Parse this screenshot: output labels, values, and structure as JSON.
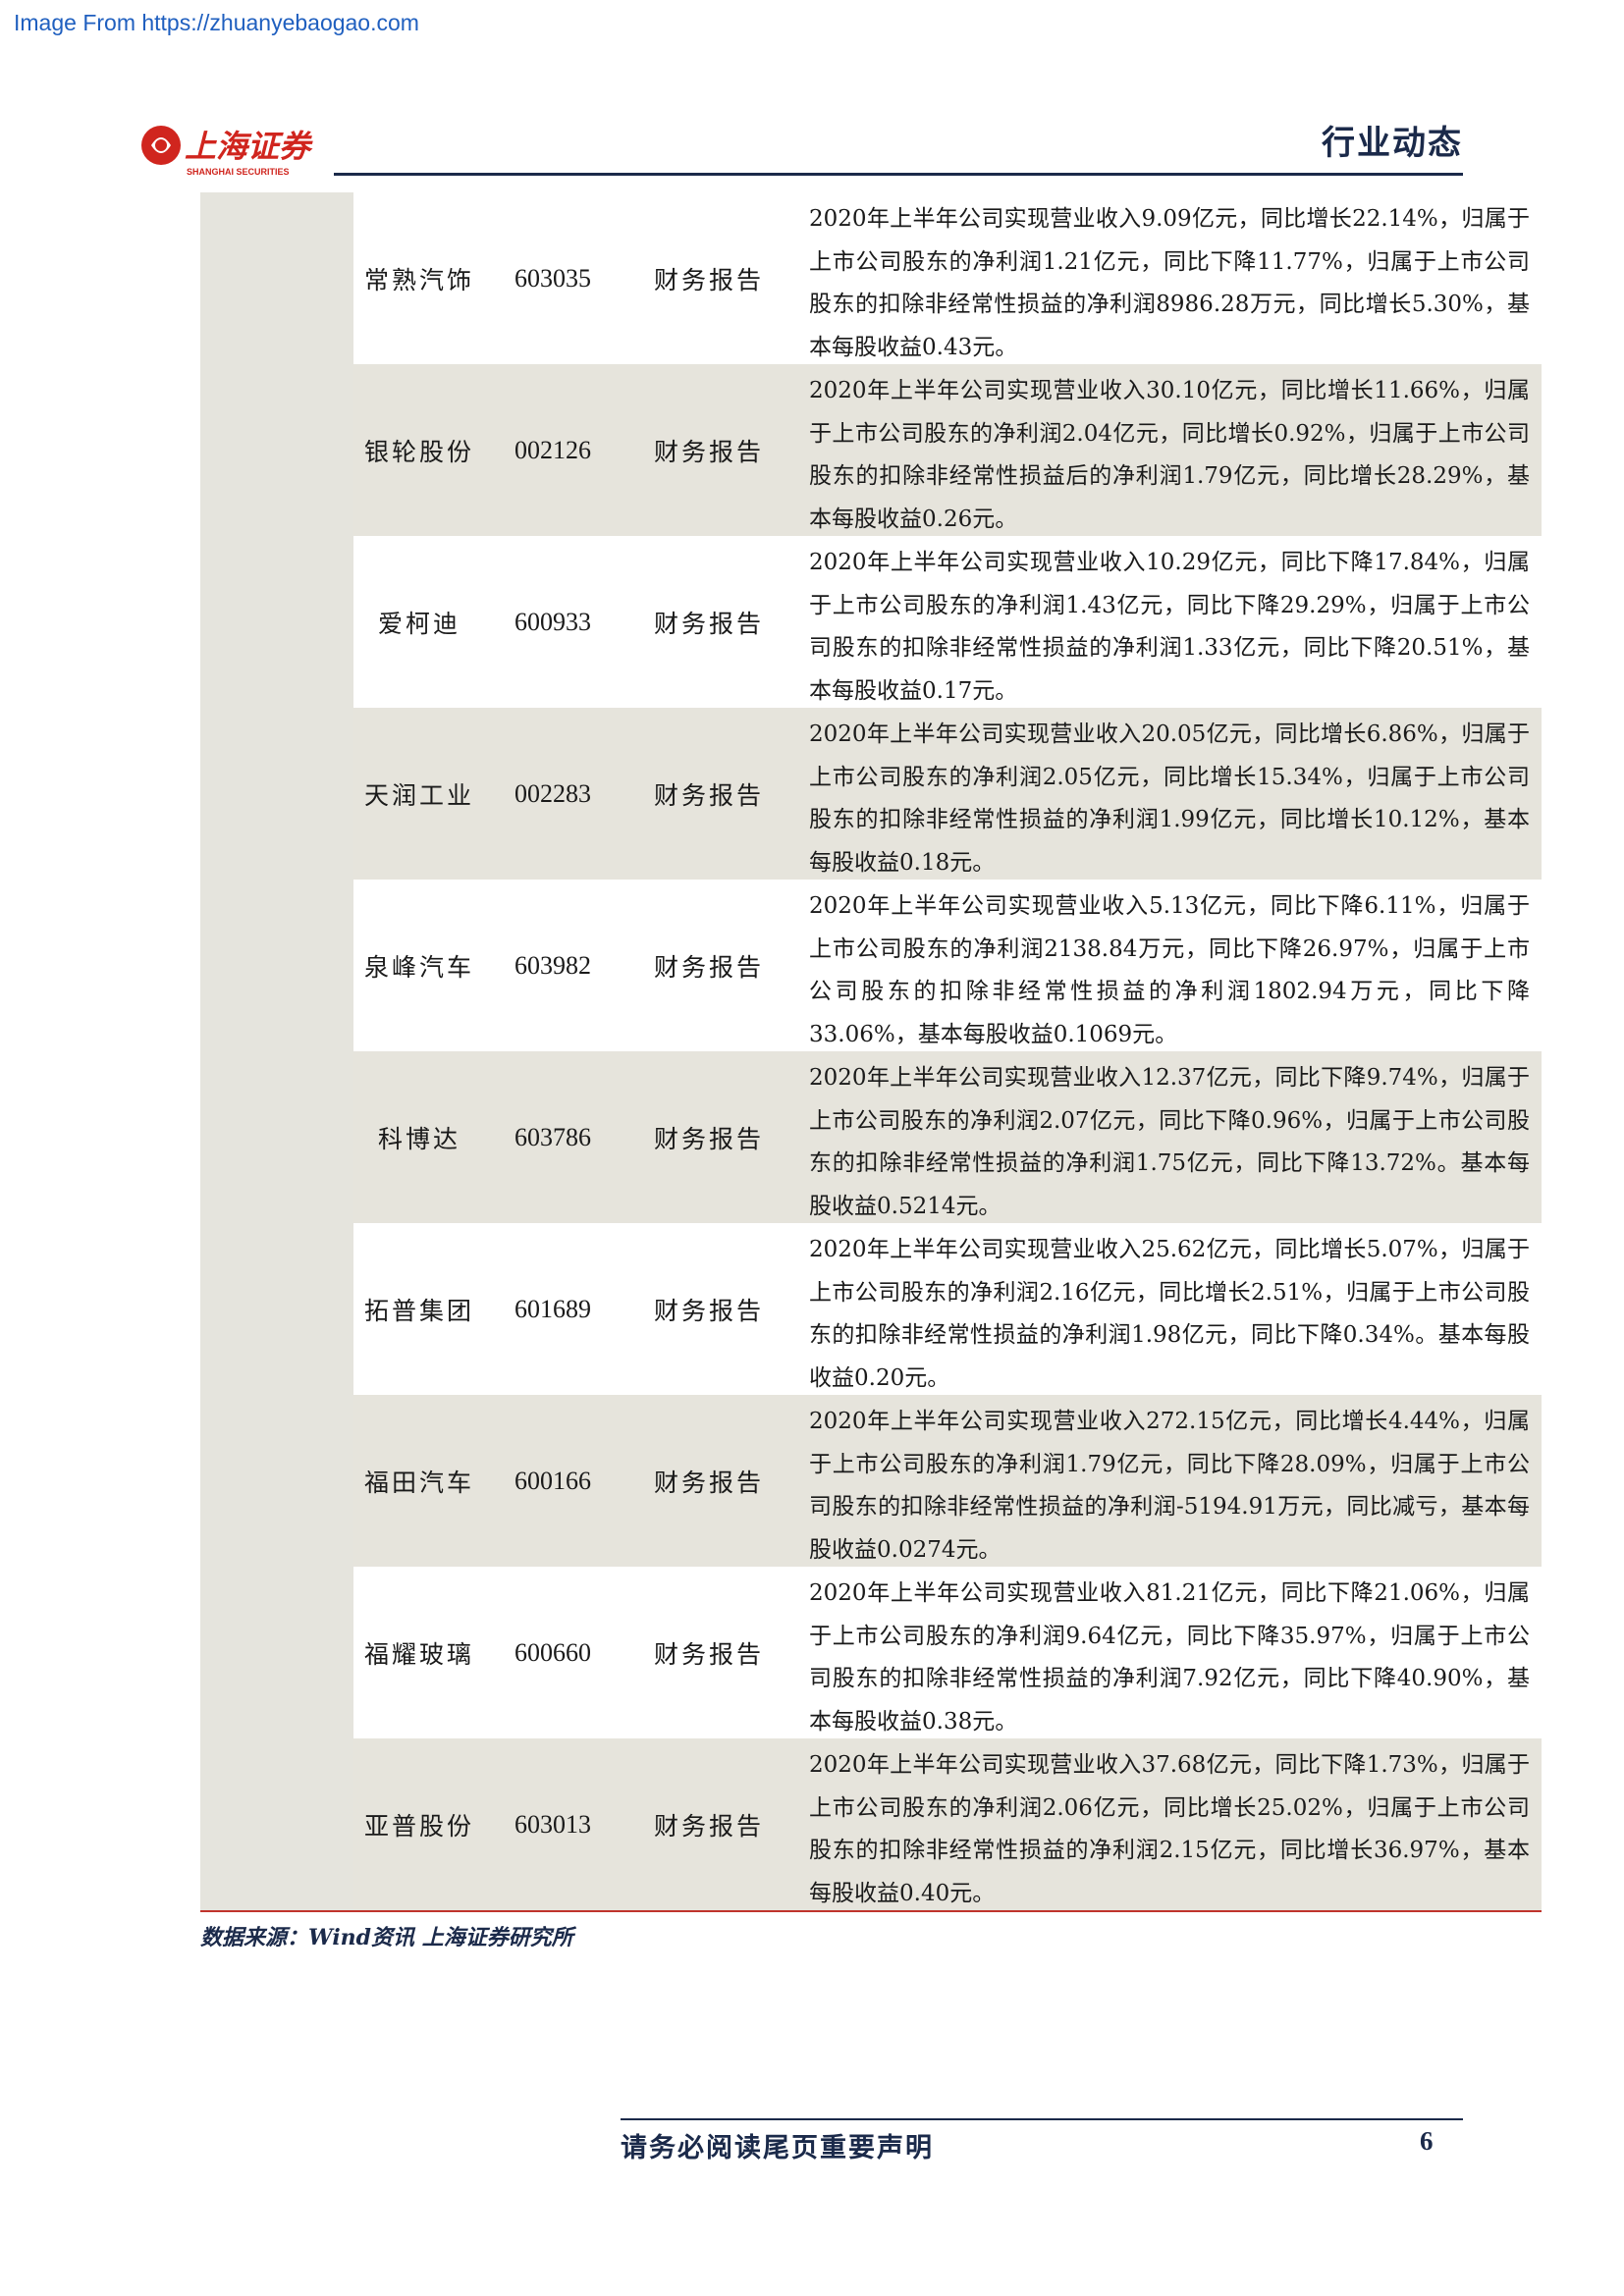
{
  "watermark": "Image From https://zhuanyebaogao.com",
  "header": {
    "brand_cn": "上海证券",
    "brand_en": "SHANGHAI SECURITIES",
    "section": "行业动态",
    "brand_color": "#d0251e"
  },
  "rows": [
    {
      "name": "常熟汽饰",
      "code": "603035",
      "type": "财务报告",
      "desc": "2020年上半年公司实现营业收入9.09亿元，同比增长22.14%，归属于上市公司股东的净利润1.21亿元，同比下降11.77%，归属于上市公司股东的扣除非经常性损益的净利润8986.28万元，同比增长5.30%，基本每股收益0.43元。"
    },
    {
      "name": "银轮股份",
      "code": "002126",
      "type": "财务报告",
      "desc": "2020年上半年公司实现营业收入30.10亿元，同比增长11.66%，归属于上市公司股东的净利润2.04亿元，同比增长0.92%，归属于上市公司股东的扣除非经常性损益后的净利润1.79亿元，同比增长28.29%，基本每股收益0.26元。"
    },
    {
      "name": "爱柯迪",
      "code": "600933",
      "type": "财务报告",
      "desc": "2020年上半年公司实现营业收入10.29亿元，同比下降17.84%，归属于上市公司股东的净利润1.43亿元，同比下降29.29%，归属于上市公司股东的扣除非经常性损益的净利润1.33亿元，同比下降20.51%，基本每股收益0.17元。"
    },
    {
      "name": "天润工业",
      "code": "002283",
      "type": "财务报告",
      "desc": "2020年上半年公司实现营业收入20.05亿元，同比增长6.86%，归属于上市公司股东的净利润2.05亿元，同比增长15.34%，归属于上市公司股东的扣除非经常性损益的净利润1.99亿元，同比增长10.12%，基本每股收益0.18元。"
    },
    {
      "name": "泉峰汽车",
      "code": "603982",
      "type": "财务报告",
      "desc": "2020年上半年公司实现营业收入5.13亿元，同比下降6.11%，归属于上市公司股东的净利润2138.84万元，同比下降26.97%，归属于上市公司股东的扣除非经常性损益的净利润1802.94万元，同比下降33.06%，基本每股收益0.1069元。"
    },
    {
      "name": "科博达",
      "code": "603786",
      "type": "财务报告",
      "desc": "2020年上半年公司实现营业收入12.37亿元，同比下降9.74%，归属于上市公司股东的净利润2.07亿元，同比下降0.96%，归属于上市公司股东的扣除非经常性损益的净利润1.75亿元，同比下降13.72%。基本每股收益0.5214元。"
    },
    {
      "name": "拓普集团",
      "code": "601689",
      "type": "财务报告",
      "desc": "2020年上半年公司实现营业收入25.62亿元，同比增长5.07%，归属于上市公司股东的净利润2.16亿元，同比增长2.51%，归属于上市公司股东的扣除非经常性损益的净利润1.98亿元，同比下降0.34%。基本每股收益0.20元。"
    },
    {
      "name": "福田汽车",
      "code": "600166",
      "type": "财务报告",
      "desc": "2020年上半年公司实现营业收入272.15亿元，同比增长4.44%，归属于上市公司股东的净利润1.79亿元，同比下降28.09%，归属于上市公司股东的扣除非经常性损益的净利润-5194.91万元，同比减亏，基本每股收益0.0274元。"
    },
    {
      "name": "福耀玻璃",
      "code": "600660",
      "type": "财务报告",
      "desc": "2020年上半年公司实现营业收入81.21亿元，同比下降21.06%，归属于上市公司股东的净利润9.64亿元，同比下降35.97%，归属于上市公司股东的扣除非经常性损益的净利润7.92亿元，同比下降40.90%，基本每股收益0.38元。"
    },
    {
      "name": "亚普股份",
      "code": "603013",
      "type": "财务报告",
      "desc": "2020年上半年公司实现营业收入37.68亿元，同比下降1.73%，归属于上市公司股东的净利润2.06亿元，同比增长25.02%，归属于上市公司股东的扣除非经常性损益的净利润2.15亿元，同比增长36.97%，基本每股收益0.40元。"
    }
  ],
  "source": "数据来源：Wind资讯 上海证券研究所",
  "footer": {
    "disclaimer": "请务必阅读尾页重要声明",
    "page": "6"
  }
}
